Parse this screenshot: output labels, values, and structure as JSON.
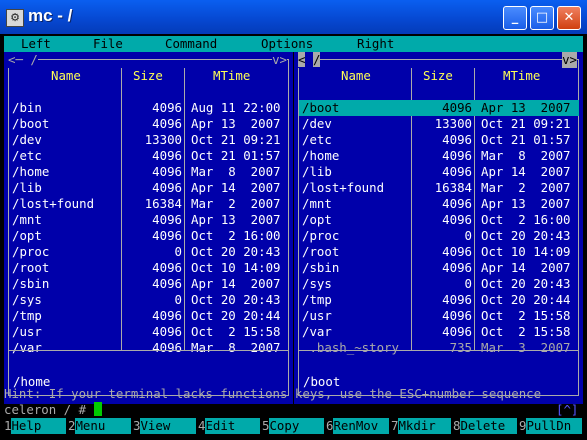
{
  "window": {
    "title": "mc - /",
    "icon": "terminal-icon",
    "minimize": "_",
    "maximize": "□",
    "close": "✕"
  },
  "menu": [
    "Left",
    "File",
    "Command",
    "Options",
    "Right"
  ],
  "columns": {
    "name": "Name",
    "size": "Size",
    "mtime": "MTime"
  },
  "left_panel": {
    "path_tab": "<─ /",
    "nav_tab": "v>",
    "rows": [
      {
        "name": "/bin",
        "size": "4096",
        "mtime": "Aug 11 22:00"
      },
      {
        "name": "/boot",
        "size": "4096",
        "mtime": "Apr 13  2007"
      },
      {
        "name": "/dev",
        "size": "13300",
        "mtime": "Oct 21 09:21"
      },
      {
        "name": "/etc",
        "size": "4096",
        "mtime": "Oct 21 01:57"
      },
      {
        "name": "/home",
        "size": "4096",
        "mtime": "Mar  8  2007"
      },
      {
        "name": "/lib",
        "size": "4096",
        "mtime": "Apr 14  2007"
      },
      {
        "name": "/lost+found",
        "size": "16384",
        "mtime": "Mar  2  2007"
      },
      {
        "name": "/mnt",
        "size": "4096",
        "mtime": "Apr 13  2007"
      },
      {
        "name": "/opt",
        "size": "4096",
        "mtime": "Oct  2 16:00"
      },
      {
        "name": "/proc",
        "size": "0",
        "mtime": "Oct 20 20:43"
      },
      {
        "name": "/root",
        "size": "4096",
        "mtime": "Oct 10 14:09"
      },
      {
        "name": "/sbin",
        "size": "4096",
        "mtime": "Apr 14  2007"
      },
      {
        "name": "/sys",
        "size": "0",
        "mtime": "Oct 20 20:43"
      },
      {
        "name": "/tmp",
        "size": "4096",
        "mtime": "Oct 20 20:44"
      },
      {
        "name": "/usr",
        "size": "4096",
        "mtime": "Oct  2 15:58"
      },
      {
        "name": "/var",
        "size": "4096",
        "mtime": "Mar  8  2007"
      }
    ],
    "status": "/home"
  },
  "right_panel": {
    "path_tab_prefix": "<",
    "path_tab": "/",
    "nav_tab": "v>",
    "selected_index": 0,
    "rows": [
      {
        "name": "/boot",
        "size": "4096",
        "mtime": "Apr 13  2007"
      },
      {
        "name": "/dev",
        "size": "13300",
        "mtime": "Oct 21 09:21"
      },
      {
        "name": "/etc",
        "size": "4096",
        "mtime": "Oct 21 01:57"
      },
      {
        "name": "/home",
        "size": "4096",
        "mtime": "Mar  8  2007"
      },
      {
        "name": "/lib",
        "size": "4096",
        "mtime": "Apr 14  2007"
      },
      {
        "name": "/lost+found",
        "size": "16384",
        "mtime": "Mar  2  2007"
      },
      {
        "name": "/mnt",
        "size": "4096",
        "mtime": "Apr 13  2007"
      },
      {
        "name": "/opt",
        "size": "4096",
        "mtime": "Oct  2 16:00"
      },
      {
        "name": "/proc",
        "size": "0",
        "mtime": "Oct 20 20:43"
      },
      {
        "name": "/root",
        "size": "4096",
        "mtime": "Oct 10 14:09"
      },
      {
        "name": "/sbin",
        "size": "4096",
        "mtime": "Apr 14  2007"
      },
      {
        "name": "/sys",
        "size": "0",
        "mtime": "Oct 20 20:43"
      },
      {
        "name": "/tmp",
        "size": "4096",
        "mtime": "Oct 20 20:44"
      },
      {
        "name": "/usr",
        "size": "4096",
        "mtime": "Oct  2 15:58"
      },
      {
        "name": "/var",
        "size": "4096",
        "mtime": "Oct  2 15:58"
      },
      {
        "name": " .bash_~story",
        "size": "735",
        "mtime": "Mar  3  2007",
        "dim": true
      }
    ],
    "status": "/boot"
  },
  "hint": "Hint: If your terminal lacks functions keys, use the ESC+number sequence",
  "prompt": "celeron / # ",
  "scroll_indicator": "[^]",
  "function_keys": [
    {
      "num": "1",
      "label": "Help"
    },
    {
      "num": "2",
      "label": "Menu"
    },
    {
      "num": "3",
      "label": "View"
    },
    {
      "num": "4",
      "label": "Edit"
    },
    {
      "num": "5",
      "label": "Copy"
    },
    {
      "num": "6",
      "label": "RenMov"
    },
    {
      "num": "7",
      "label": "Mkdir"
    },
    {
      "num": "8",
      "label": "Delete"
    },
    {
      "num": "9",
      "label": "PullDn"
    }
  ],
  "colors": {
    "panel_bg": "#0000aa",
    "accent": "#00aaaa",
    "header": "#ffff55",
    "text": "#ffffff",
    "dim": "#aaaaaa"
  }
}
